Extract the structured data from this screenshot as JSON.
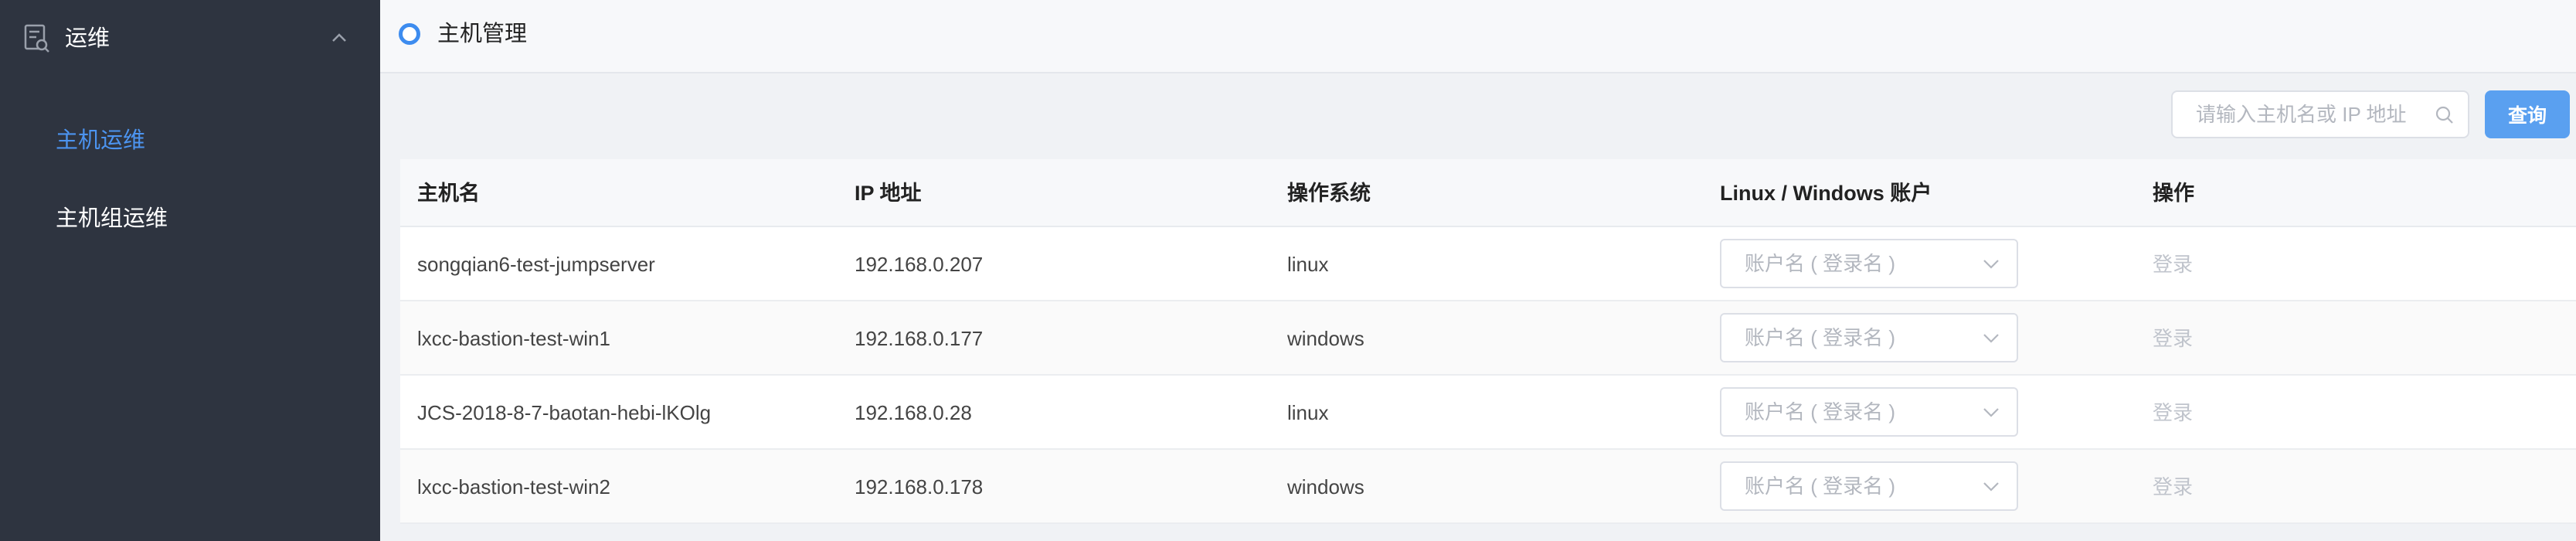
{
  "sidebar": {
    "header": {
      "label": "运维",
      "icon": "ops-document-icon",
      "chevron": "chevron-up-icon"
    },
    "items": [
      {
        "label": "主机运维",
        "active": true
      },
      {
        "label": "主机组运维",
        "active": false
      }
    ]
  },
  "header": {
    "title": "主机管理"
  },
  "search": {
    "placeholder": "请输入主机名或 IP 地址",
    "value": "",
    "button_label": "查询"
  },
  "table": {
    "columns": [
      "主机名",
      "IP 地址",
      "操作系统",
      "Linux / Windows 账户",
      "操作"
    ],
    "account_placeholder": "账户名 ( 登录名 )",
    "login_label": "登录",
    "rows": [
      {
        "hostname": "songqian6-test-jumpserver",
        "ip": "192.168.0.207",
        "os": "linux"
      },
      {
        "hostname": "lxcc-bastion-test-win1",
        "ip": "192.168.0.177",
        "os": "windows"
      },
      {
        "hostname": "JCS-2018-8-7-baotan-hebi-lKOlg",
        "ip": "192.168.0.28",
        "os": "linux"
      },
      {
        "hostname": "lxcc-bastion-test-win2",
        "ip": "192.168.0.178",
        "os": "windows"
      }
    ]
  },
  "colors": {
    "sidebar_bg": "#2e3440",
    "accent": "#4c94f0",
    "button": "#5aa0f0"
  }
}
